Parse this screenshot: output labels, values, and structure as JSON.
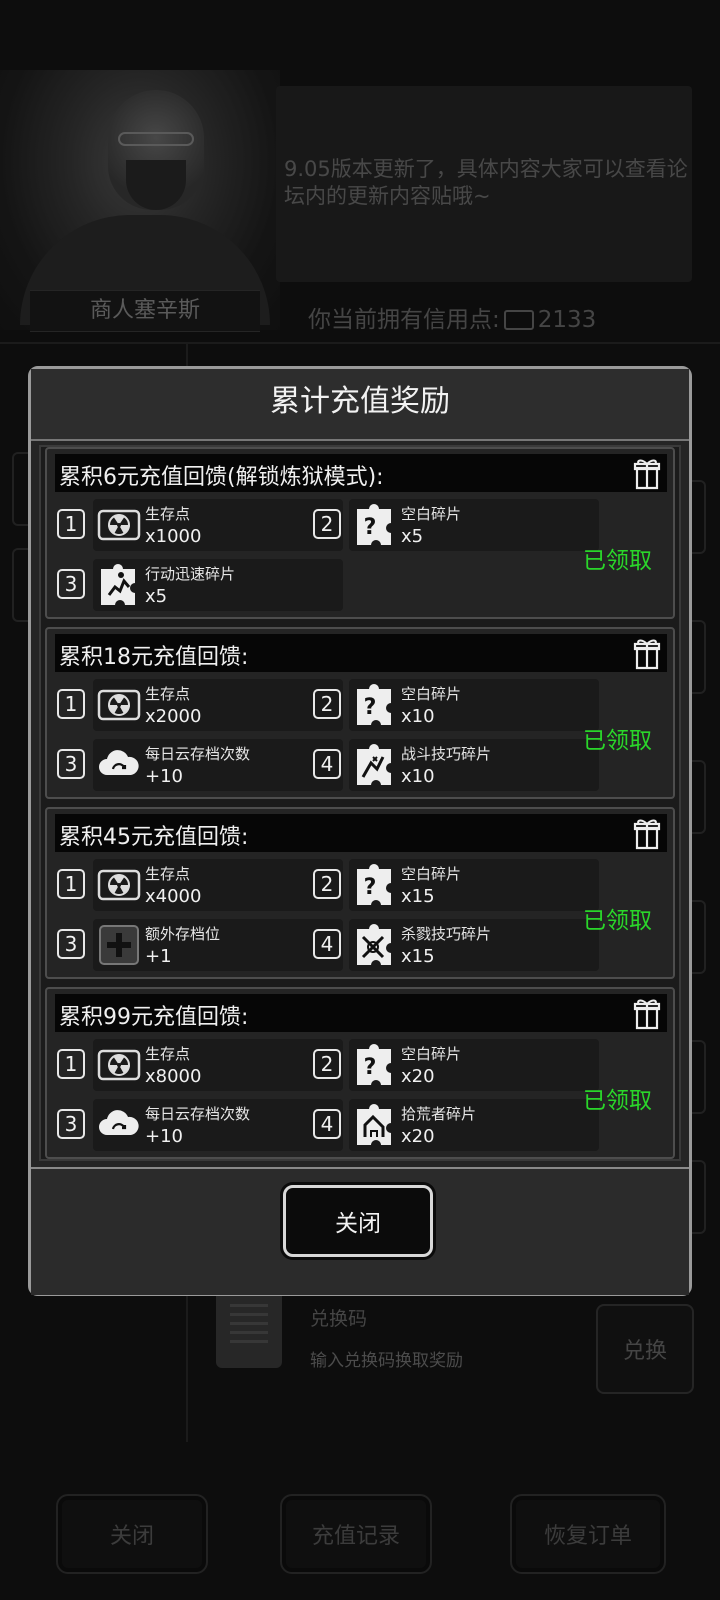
{
  "background": {
    "merchant_name": "商人塞辛斯",
    "speech_text": "9.05版本更新了，具体内容大家可以查看论坛内的更新内容贴哦~",
    "credits_label": "你当前拥有信用点:",
    "credits_value": "2133",
    "redeem_title": "兑换码",
    "redeem_placeholder": "输入兑换码换取奖励",
    "redeem_button": "兑换",
    "bottom_buttons": [
      "关闭",
      "充值记录",
      "恢复订单"
    ]
  },
  "modal": {
    "title": "累计充值奖励",
    "close_label": "关闭",
    "tiers": [
      {
        "title": "累积6元充值回馈(解锁炼狱模式):",
        "status": "已领取",
        "rewards": [
          {
            "num": "1",
            "name": "生存点",
            "qty": "x1000",
            "icon": "radiation-icon"
          },
          {
            "num": "2",
            "name": "空白碎片",
            "qty": "x5",
            "icon": "puzzle-question-icon"
          },
          {
            "num": "3",
            "name": "行动迅速碎片",
            "qty": "x5",
            "icon": "puzzle-runner-icon"
          }
        ]
      },
      {
        "title": "累积18元充值回馈:",
        "status": "已领取",
        "rewards": [
          {
            "num": "1",
            "name": "生存点",
            "qty": "x2000",
            "icon": "radiation-icon"
          },
          {
            "num": "2",
            "name": "空白碎片",
            "qty": "x10",
            "icon": "puzzle-question-icon"
          },
          {
            "num": "3",
            "name": "每日云存档次数",
            "qty": "+10",
            "icon": "cloud-icon"
          },
          {
            "num": "4",
            "name": "战斗技巧碎片",
            "qty": "x10",
            "icon": "puzzle-fight-icon"
          }
        ]
      },
      {
        "title": "累积45元充值回馈:",
        "status": "已领取",
        "rewards": [
          {
            "num": "1",
            "name": "生存点",
            "qty": "x4000",
            "icon": "radiation-icon"
          },
          {
            "num": "2",
            "name": "空白碎片",
            "qty": "x15",
            "icon": "puzzle-question-icon"
          },
          {
            "num": "3",
            "name": "额外存档位",
            "qty": "+1",
            "icon": "plus-slot-icon"
          },
          {
            "num": "4",
            "name": "杀戮技巧碎片",
            "qty": "x15",
            "icon": "puzzle-kill-icon"
          }
        ]
      },
      {
        "title": "累积99元充值回馈:",
        "status": "已领取",
        "rewards": [
          {
            "num": "1",
            "name": "生存点",
            "qty": "x8000",
            "icon": "radiation-icon"
          },
          {
            "num": "2",
            "name": "空白碎片",
            "qty": "x20",
            "icon": "puzzle-question-icon"
          },
          {
            "num": "3",
            "name": "每日云存档次数",
            "qty": "+10",
            "icon": "cloud-icon"
          },
          {
            "num": "4",
            "name": "拾荒者碎片",
            "qty": "x20",
            "icon": "puzzle-scavenger-icon"
          }
        ]
      }
    ]
  },
  "colors": {
    "claimed_green": "#2ad62a",
    "modal_border": "#9a9a9a",
    "background": "#141414"
  }
}
